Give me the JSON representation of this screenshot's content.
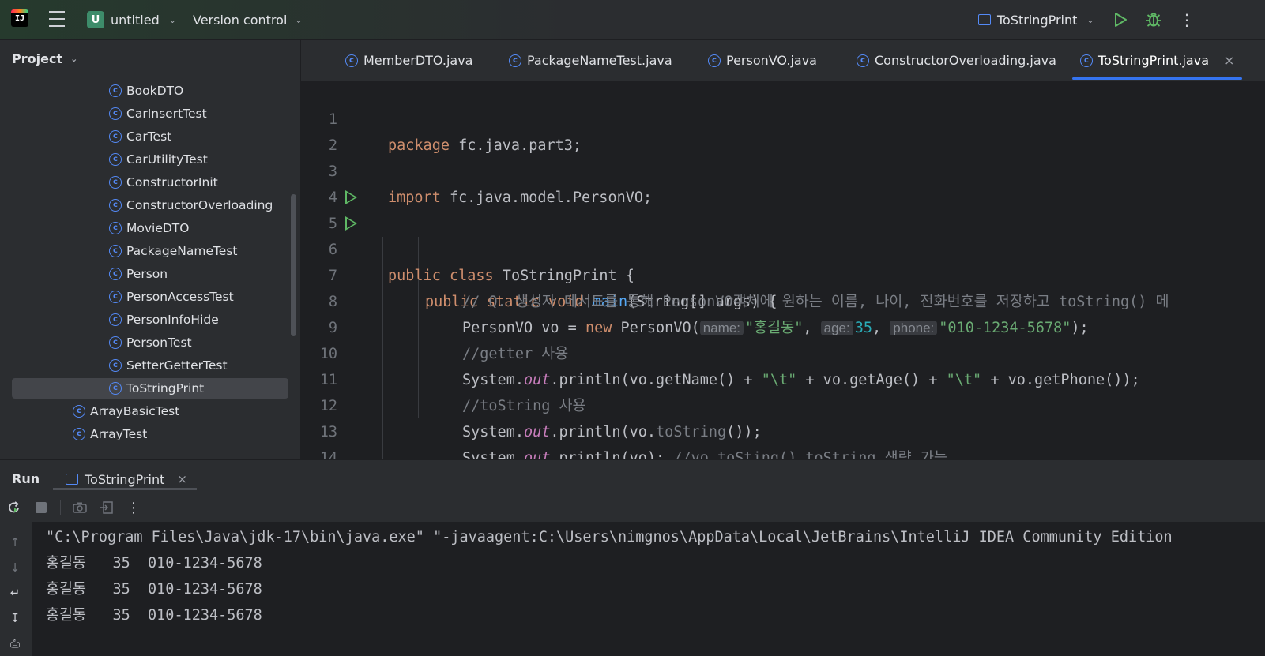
{
  "toolbar": {
    "logo_text": "IJ",
    "project_initial": "U",
    "project_name": "untitled",
    "vcs_label": "Version control",
    "run_config_name": "ToStringPrint",
    "icons": [
      "menu-icon",
      "chevron-down-icon",
      "run-icon",
      "debug-icon",
      "more-icon"
    ]
  },
  "project_panel": {
    "title": "Project",
    "items": [
      {
        "label": "BookDTO",
        "selected": false
      },
      {
        "label": "CarInsertTest",
        "selected": false
      },
      {
        "label": "CarTest",
        "selected": false
      },
      {
        "label": "CarUtilityTest",
        "selected": false
      },
      {
        "label": "ConstructorInit",
        "selected": false
      },
      {
        "label": "ConstructorOverloading",
        "selected": false
      },
      {
        "label": "MovieDTO",
        "selected": false
      },
      {
        "label": "PackageNameTest",
        "selected": false
      },
      {
        "label": "Person",
        "selected": false
      },
      {
        "label": "PersonAccessTest",
        "selected": false
      },
      {
        "label": "PersonInfoHide",
        "selected": false
      },
      {
        "label": "PersonTest",
        "selected": false
      },
      {
        "label": "SetterGetterTest",
        "selected": false
      },
      {
        "label": "ToStringPrint",
        "selected": true
      },
      {
        "label": "ArrayBasicTest",
        "selected": false
      },
      {
        "label": "ArrayTest",
        "selected": false
      }
    ]
  },
  "editor_tabs": [
    {
      "label": "MemberDTO.java",
      "active": false
    },
    {
      "label": "PackageNameTest.java",
      "active": false
    },
    {
      "label": "PersonVO.java",
      "active": false
    },
    {
      "label": "ConstructorOverloading.java",
      "active": false
    },
    {
      "label": "ToStringPrint.java",
      "active": true
    }
  ],
  "code": {
    "line_numbers": [
      "1",
      "2",
      "3",
      "4",
      "5",
      "6",
      "7",
      "8",
      "9",
      "10",
      "11",
      "12",
      "13",
      "14"
    ],
    "l1": {
      "kw": "package",
      "rest": " fc.java.part3;"
    },
    "l3": {
      "kw": "import",
      "rest": " fc.java.model.PersonVO;"
    },
    "l5": {
      "kw1": "public",
      "kw2": "class",
      "rest": " ToStringPrint {"
    },
    "l6": {
      "kw1": "public",
      "kw2": "static",
      "kw3": "void",
      "fn": "main",
      "rest": "(String[] args) {"
    },
    "l7": {
      "comment": "// Q. 생성자 메서드를 통해 PersonVO객체에 원하는 이름, 나이, 전화번호를 저장하고 toString() 메"
    },
    "l8": {
      "pre": "PersonVO vo = ",
      "kw": "new",
      "ctor": " PersonVO(",
      "hint1": "name:",
      "s1": "\"홍길동\"",
      "c1": ", ",
      "hint2": "age:",
      "n1": "35",
      "c2": ", ",
      "hint3": "phone:",
      "s2": "\"010-1234-5678\"",
      "end": ");"
    },
    "l9": {
      "comment": "//getter 사용"
    },
    "l10": {
      "pre": "System.",
      "field": "out",
      "mid": ".println(vo.getName() + ",
      "s1": "\"\\t\"",
      "mid2": " + vo.getAge() + ",
      "s2": "\"\\t\"",
      "end": " + vo.getPhone());"
    },
    "l11": {
      "comment": "//toString 사용"
    },
    "l12": {
      "pre": "System.",
      "field": "out",
      "mid": ".println(vo.",
      "dim": "toString",
      "end": "());"
    },
    "l13": {
      "pre": "System.",
      "field": "out",
      "mid": ".println(vo); ",
      "comment": "//vo.toSting() toString 생략 가능"
    },
    "l14": {
      "text": "}"
    }
  },
  "run_panel": {
    "title": "Run",
    "tab_label": "ToStringPrint",
    "console_lines": [
      "\"C:\\Program Files\\Java\\jdk-17\\bin\\java.exe\" \"-javaagent:C:\\Users\\nimgnos\\AppData\\Local\\JetBrains\\IntelliJ IDEA Community Edition",
      "홍길동   35  010-1234-5678",
      "홍길동   35  010-1234-5678",
      "홍길동   35  010-1234-5678"
    ]
  },
  "colors": {
    "keyword": "#cf8e6d",
    "function": "#56a8f5",
    "string": "#6aab73",
    "number": "#2aacb8",
    "comment": "#7a7e85",
    "static_field": "#c77dbb",
    "accent": "#3574f0",
    "run_green": "#5fb865"
  }
}
